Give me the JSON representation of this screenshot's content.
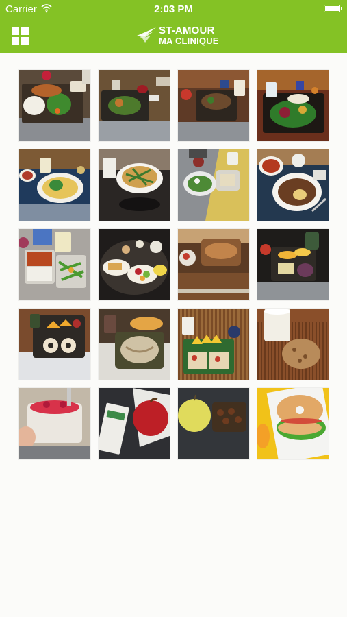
{
  "status_bar": {
    "carrier": "Carrier",
    "time": "2:03 PM",
    "wifi_icon": "wifi-icon",
    "battery_icon": "battery-icon"
  },
  "header": {
    "menu_icon": "grid-menu-icon",
    "logo_line1": "ST-AMOUR",
    "logo_line2": "MA CLINIQUE",
    "brand_color": "#84c225"
  },
  "gallery": {
    "tiles": [
      {
        "subject": "tray with fried rice, cauliflower and green beans"
      },
      {
        "subject": "tray with vegetables and drink"
      },
      {
        "subject": "tray with stew and drinks"
      },
      {
        "subject": "tray with mixed vegetables and milk"
      },
      {
        "subject": "plate with vegetables and soup"
      },
      {
        "subject": "bowl of pasta with milk"
      },
      {
        "subject": "tray with salad and sandwich"
      },
      {
        "subject": "plate of stew with soup"
      },
      {
        "subject": "container with chicken, rice and green beans"
      },
      {
        "subject": "table with fruits and snacks"
      },
      {
        "subject": "bowl of granola with fruit"
      },
      {
        "subject": "tray with orange slices and drink"
      },
      {
        "subject": "plate with bagels and orange slices"
      },
      {
        "subject": "bowl of cereal with chocolate milk"
      },
      {
        "subject": "mat with mango slices and toast"
      },
      {
        "subject": "glass of milk and cookie"
      },
      {
        "subject": "hand holding fruit yogurt cup"
      },
      {
        "subject": "apple and snack bar"
      },
      {
        "subject": "apple and dates container"
      },
      {
        "subject": "bagel sandwich with lettuce"
      }
    ]
  }
}
